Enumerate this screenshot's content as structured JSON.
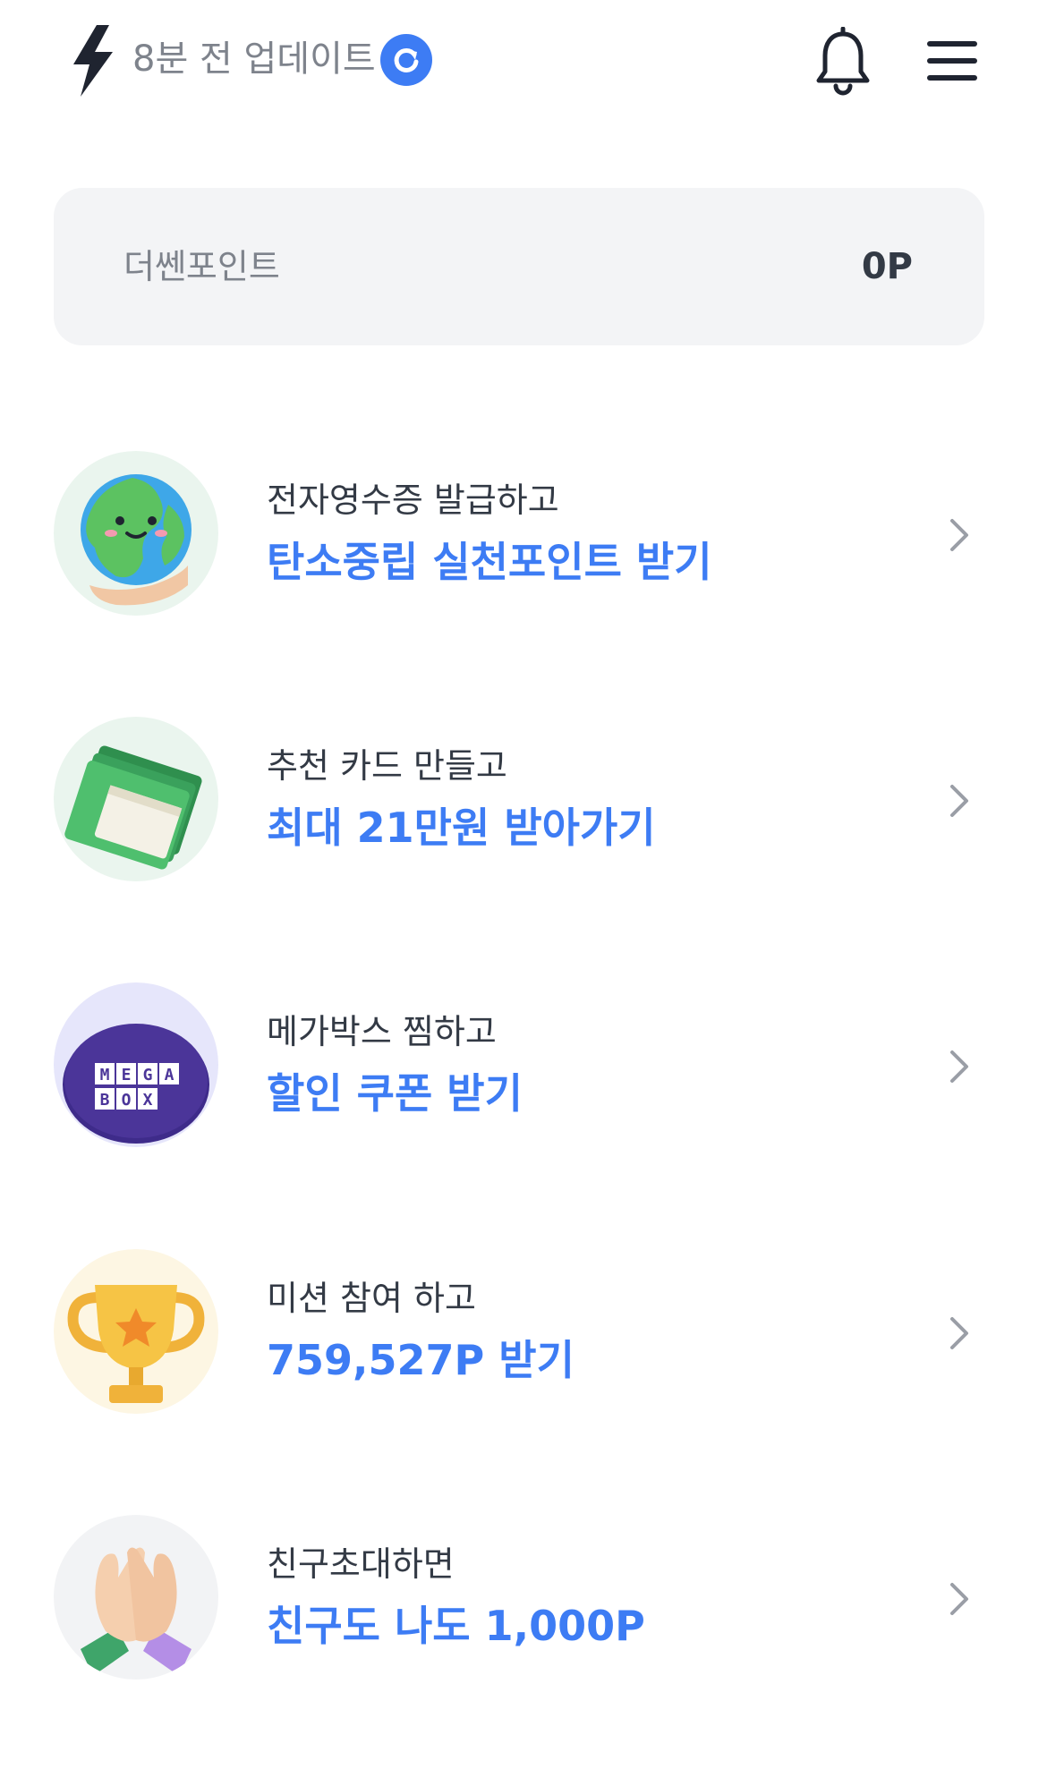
{
  "header": {
    "update_text": "8분 전 업데이트"
  },
  "points": {
    "label": "더쎈포인트",
    "value": "0P"
  },
  "items": [
    {
      "subtitle": "전자영수증 발급하고",
      "title": "탄소중립 실천포인트 받기",
      "icon": "globe-hand-icon",
      "bg": "#eaf5ee"
    },
    {
      "subtitle": "추천 카드 만들고",
      "title": "최대 21만원 받아가기",
      "icon": "money-stack-icon",
      "bg": "#eaf5ee"
    },
    {
      "subtitle": "메가박스 찜하고",
      "title": "할인 쿠폰 받기",
      "icon": "megabox-logo",
      "bg": "#e6e6fb",
      "logo_letters": [
        "M",
        "E",
        "G",
        "A",
        "B",
        "O",
        "X"
      ]
    },
    {
      "subtitle": "미션 참여 하고",
      "title": "759,527P 받기",
      "icon": "trophy-icon",
      "bg": "#fdf6e3"
    },
    {
      "subtitle": "친구초대하면",
      "title": "친구도 나도 1,000P",
      "icon": "high-five-icon",
      "bg": "#f2f3f5"
    }
  ],
  "colors": {
    "accent": "#3d7cf4",
    "text": "#333a45",
    "muted": "#7e838c",
    "card_bg": "#f3f4f6"
  }
}
